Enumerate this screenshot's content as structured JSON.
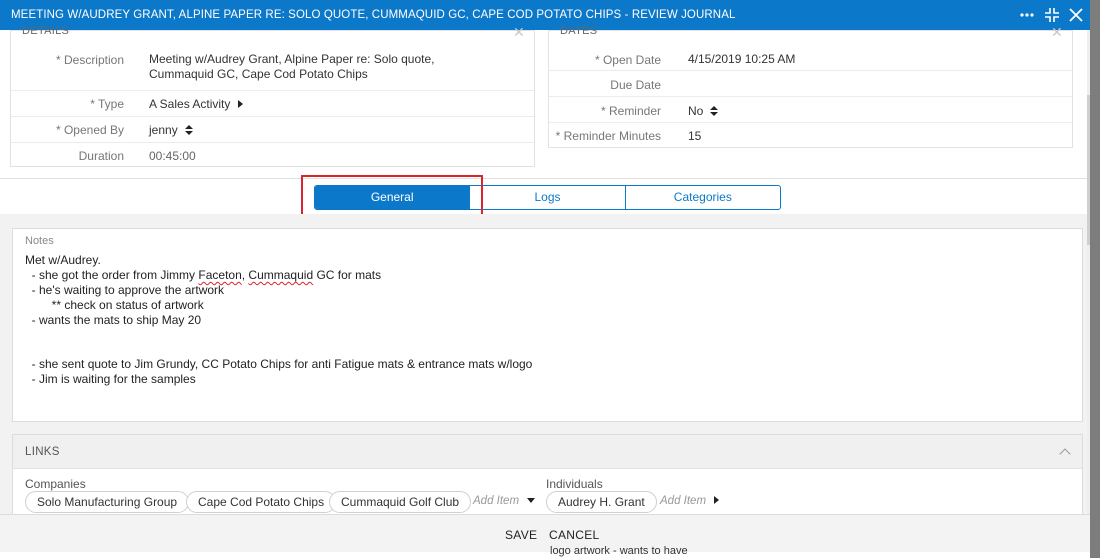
{
  "window": {
    "title": "MEETING W/AUDREY GRANT, ALPINE PAPER RE: SOLO QUOTE, CUMMAQUID GC, CAPE COD POTATO CHIPS - REVIEW JOURNAL"
  },
  "details": {
    "header": "DETAILS",
    "description_label": "* Description",
    "description_line1": "Meeting w/Audrey Grant, Alpine Paper re: Solo quote,",
    "description_line2": "Cummaquid GC, Cape Cod Potato Chips",
    "type_label": "* Type",
    "type_value": "A Sales Activity",
    "opened_by_label": "* Opened By",
    "opened_by_value": "jenny",
    "duration_label": "Duration",
    "duration_value": "00:45:00"
  },
  "dates": {
    "header": "DATES",
    "open_date_label": "* Open Date",
    "open_date_value": "4/15/2019 10:25 AM",
    "due_date_label": "Due Date",
    "due_date_value": "",
    "reminder_label": "* Reminder",
    "reminder_value": "No",
    "reminder_minutes_label": "* Reminder Minutes",
    "reminder_minutes_value": "15"
  },
  "tabs": [
    {
      "label": "General",
      "active": true
    },
    {
      "label": "Logs",
      "active": false
    },
    {
      "label": "Categories",
      "active": false
    }
  ],
  "notes": {
    "label": "Notes",
    "lines": [
      "Met w/Audrey.",
      "  - she got the order from Jimmy ",
      "  - he's waiting to approve the artwork",
      "        ** check on status of artwork",
      "  - wants the mats to ship May 20",
      "",
      "",
      "  - she sent quote to Jim Grundy, CC Potato Chips for anti Fatigue mats & entrance mats w/logo",
      "  - Jim is waiting for the samples"
    ],
    "line2_word1": "Faceton",
    "line2_sep": ", ",
    "line2_word2": "Cummaquid",
    "line2_tail": " GC for mats"
  },
  "links": {
    "header": "LINKS",
    "companies_label": "Companies",
    "companies": [
      "Solo Manufacturing Group",
      "Cape Cod Potato Chips",
      "Cummaquid Golf Club"
    ],
    "companies_add": "Add Item",
    "individuals_label": "Individuals",
    "individuals": [
      "Audrey H. Grant"
    ],
    "individuals_add": "Add Item"
  },
  "footer": {
    "save_label": "SAVE",
    "cancel_label": "CANCEL"
  },
  "background_text": "logo artwork - wants to have",
  "colors": {
    "accent": "#0b78c9",
    "highlight": "#d9262c"
  }
}
